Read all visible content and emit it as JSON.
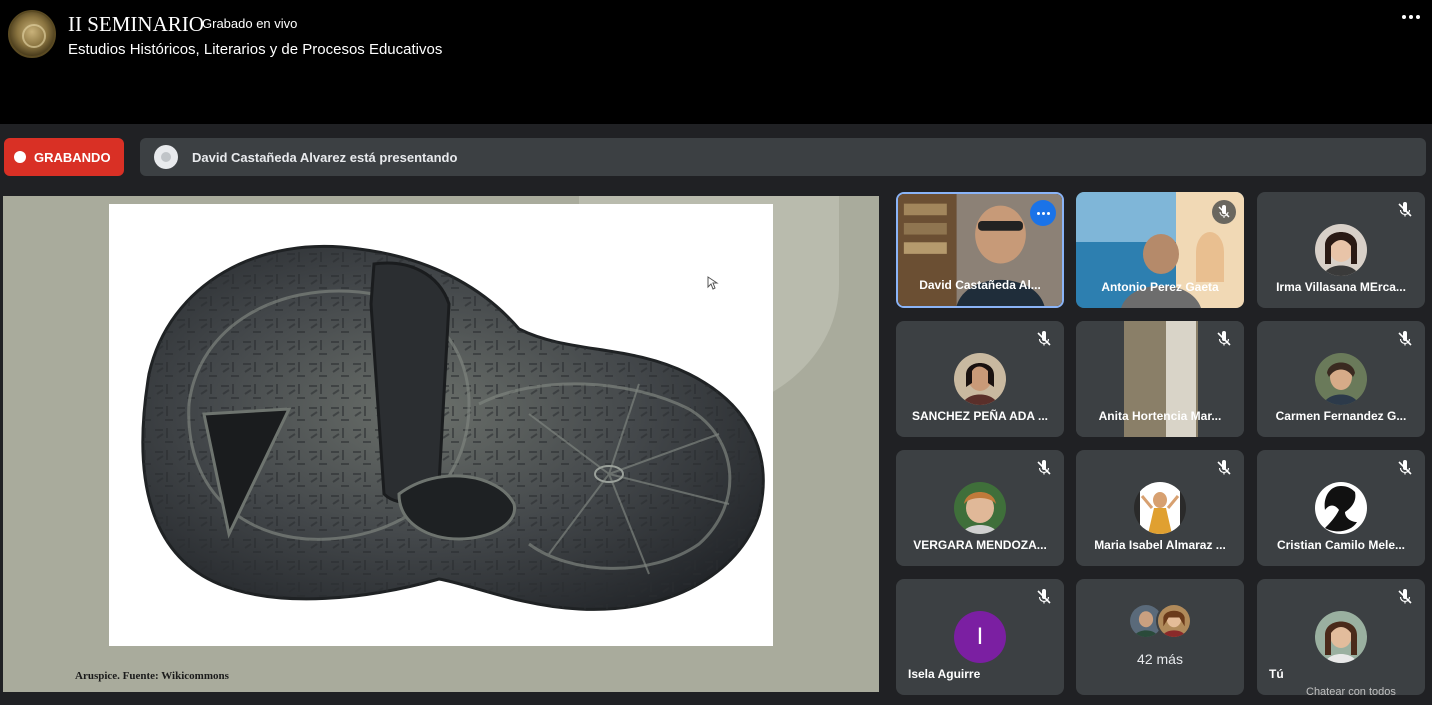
{
  "header": {
    "title": "II SEMINARIO",
    "live_tag": "Grabado en vivo",
    "subtitle": "Estudios Históricos, Literarios y de Procesos Educativos",
    "avatar_icon": "channel-seal-icon",
    "more_icon": "more-horizontal-icon"
  },
  "meet": {
    "recording_label": "GRABANDO",
    "recording_color": "#d93025",
    "presenting_text": "David Castañeda Alvarez está presentando",
    "presentation": {
      "caption": "Aruspice. Fuente: Wikicommons"
    },
    "tiles": [
      {
        "name": "David Castañeda Al...",
        "type": "video",
        "active": true,
        "status": "speaking"
      },
      {
        "name": "Antonio Perez Gaeta",
        "type": "video",
        "active": false,
        "status": "muted"
      },
      {
        "name": "Irma Villasana MErca...",
        "type": "avatar",
        "status": "muted"
      },
      {
        "name": "SANCHEZ PEÑA ADA ...",
        "type": "avatar",
        "status": "muted"
      },
      {
        "name": "Anita Hortencia Mar...",
        "type": "video",
        "status": "muted"
      },
      {
        "name": "Carmen Fernandez G...",
        "type": "avatar",
        "status": "muted"
      },
      {
        "name": "VERGARA MENDOZA...",
        "type": "avatar",
        "status": "muted"
      },
      {
        "name": "Maria Isabel Almaraz ...",
        "type": "avatar",
        "status": "muted"
      },
      {
        "name": "Cristian Camilo Mele...",
        "type": "avatar",
        "status": "muted"
      },
      {
        "name": "Isela Aguirre",
        "type": "initial",
        "initial": "I",
        "color": "#7b1fa2",
        "status": "muted"
      },
      {
        "name": "42 más",
        "type": "overflow"
      },
      {
        "name": "Tú",
        "type": "avatar",
        "status": "muted"
      }
    ],
    "chat_hint": "Chatear con todos"
  }
}
